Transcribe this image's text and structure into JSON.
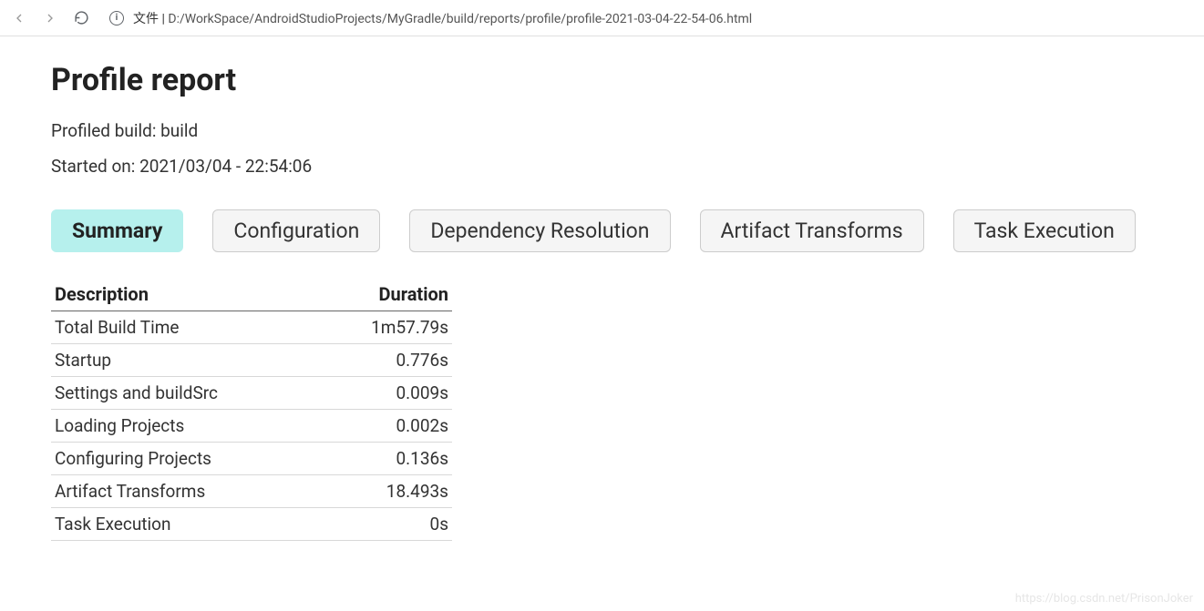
{
  "browser": {
    "url_prefix": "文件 | ",
    "url": "D:/WorkSpace/AndroidStudioProjects/MyGradle/build/reports/profile/profile-2021-03-04-22-54-06.html"
  },
  "page": {
    "title": "Profile report",
    "profiled_build": "Profiled build: build",
    "started_on": "Started on: 2021/03/04 - 22:54:06"
  },
  "tabs": [
    {
      "label": "Summary",
      "active": true
    },
    {
      "label": "Configuration",
      "active": false
    },
    {
      "label": "Dependency Resolution",
      "active": false
    },
    {
      "label": "Artifact Transforms",
      "active": false
    },
    {
      "label": "Task Execution",
      "active": false
    }
  ],
  "table": {
    "headers": {
      "description": "Description",
      "duration": "Duration"
    },
    "rows": [
      {
        "description": "Total Build Time",
        "duration": "1m57.79s"
      },
      {
        "description": "Startup",
        "duration": "0.776s"
      },
      {
        "description": "Settings and buildSrc",
        "duration": "0.009s"
      },
      {
        "description": "Loading Projects",
        "duration": "0.002s"
      },
      {
        "description": "Configuring Projects",
        "duration": "0.136s"
      },
      {
        "description": "Artifact Transforms",
        "duration": "18.493s"
      },
      {
        "description": "Task Execution",
        "duration": "0s"
      }
    ]
  },
  "watermark": "https://blog.csdn.net/PrisonJoker"
}
